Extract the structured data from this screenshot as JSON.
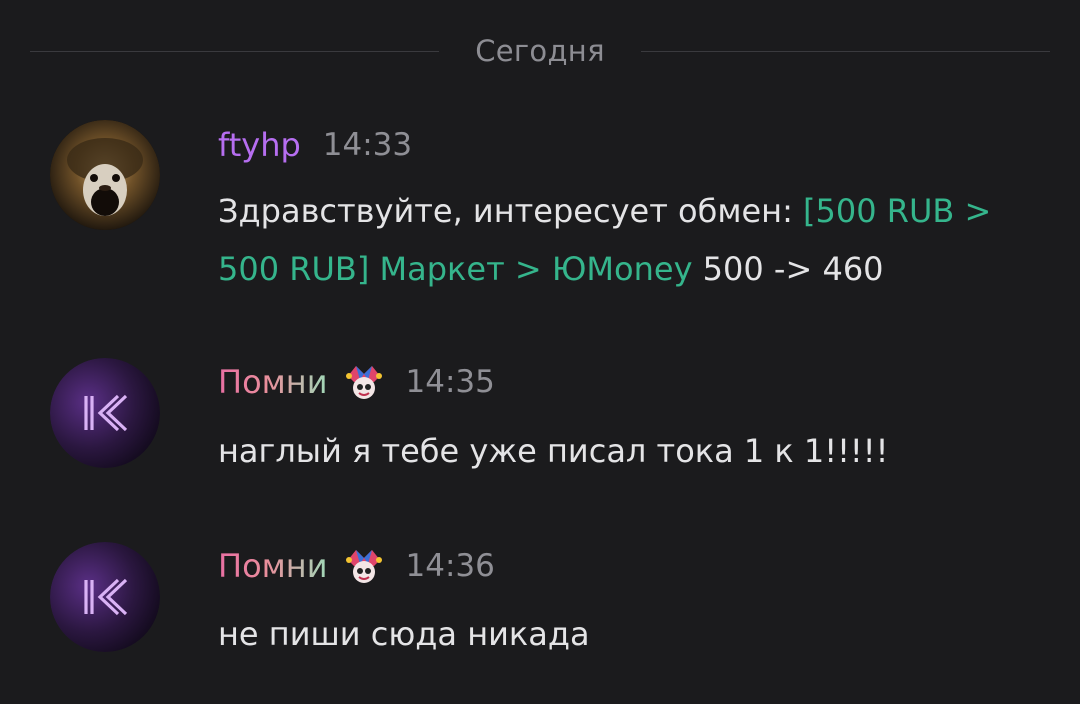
{
  "day_separator": "Сегодня",
  "messages": [
    {
      "author": "ftyhp",
      "time": "14:33",
      "text_before": "Здравствуйте, интересует обмен: ",
      "link": "[500 RUB > 500 RUB] Маркет > ЮMoney",
      "text_after": " 500 -> 460",
      "avatar_icon": "monkey-avatar-icon"
    },
    {
      "author": "Помни",
      "time": "14:35",
      "text": "наглый я тебе уже писал тока 1 к 1!!!!!",
      "avatar_icon": "k-logo-avatar-icon",
      "badge_icon": "jester-badge-icon"
    },
    {
      "author": "Помни",
      "time": "14:36",
      "text": "не пиши сюда никада",
      "avatar_icon": "k-logo-avatar-icon",
      "badge_icon": "jester-badge-icon"
    }
  ],
  "colors": {
    "background": "#1b1b1d",
    "ftyhp_name": "#b66ef0",
    "link": "#35b58c",
    "timestamp": "#8f8f95"
  }
}
